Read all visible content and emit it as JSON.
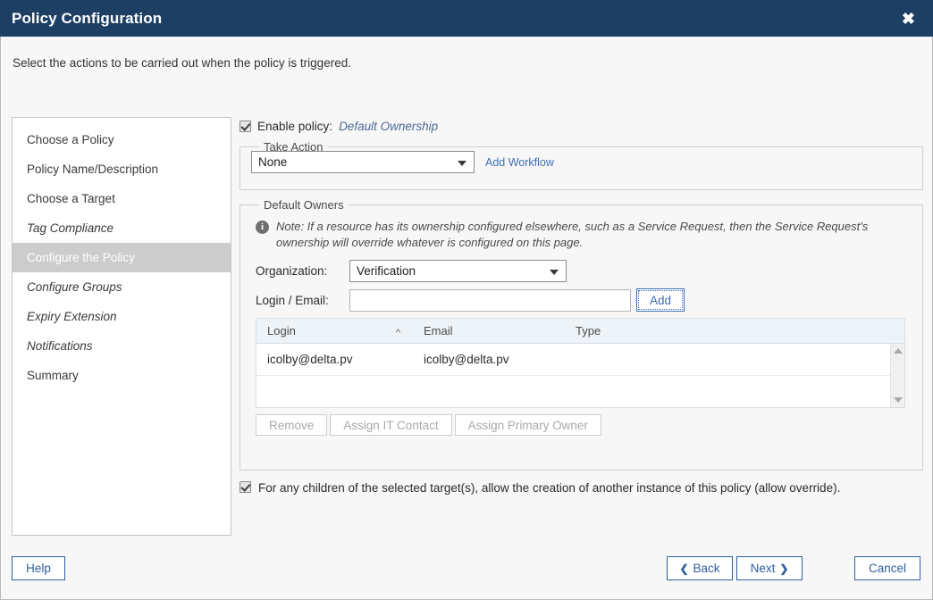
{
  "window": {
    "title": "Policy Configuration",
    "close_icon": "close-icon",
    "close_glyph": "✖"
  },
  "intro": "Select the actions to be carried out when the policy is triggered.",
  "sidebar": {
    "items": [
      {
        "label": "Choose a Policy",
        "style": "normal",
        "active": false
      },
      {
        "label": "Policy Name/Description",
        "style": "normal",
        "active": false
      },
      {
        "label": "Choose a Target",
        "style": "normal",
        "active": false
      },
      {
        "label": "Tag Compliance",
        "style": "italic",
        "active": false
      },
      {
        "label": "Configure the Policy",
        "style": "normal",
        "active": true
      },
      {
        "label": "Configure Groups",
        "style": "italic",
        "active": false
      },
      {
        "label": "Expiry Extension",
        "style": "italic",
        "active": false
      },
      {
        "label": "Notifications",
        "style": "italic",
        "active": false
      },
      {
        "label": "Summary",
        "style": "normal",
        "active": false
      }
    ]
  },
  "enable_policy": {
    "checked": true,
    "label": "Enable policy:",
    "policy_name": "Default Ownership"
  },
  "take_action": {
    "legend": "Take Action",
    "select_value": "None",
    "select_options": [
      "None"
    ],
    "add_workflow_link": "Add Workflow"
  },
  "default_owners": {
    "legend": "Default Owners",
    "note_icon": "info-icon",
    "note": "Note: If a resource has its ownership configured elsewhere, such as a Service Request, then the Service Request's ownership will override whatever is configured on this page.",
    "organization_label": "Organization:",
    "organization_value": "Verification",
    "organization_options": [
      "Verification"
    ],
    "login_label": "Login / Email:",
    "login_value": "",
    "login_placeholder": "",
    "add_label": "Add",
    "table": {
      "columns": [
        "Login",
        "Email",
        "Type"
      ],
      "sort_column": "Login",
      "sort_caret": "^",
      "rows": [
        {
          "login": "icolby@delta.pv",
          "email": "icolby@delta.pv",
          "type": ""
        }
      ]
    },
    "actions": [
      {
        "label": "Remove",
        "enabled": false
      },
      {
        "label": "Assign IT Contact",
        "enabled": false
      },
      {
        "label": "Assign Primary Owner",
        "enabled": false
      }
    ]
  },
  "override": {
    "checked": true,
    "text": "For any children of the selected target(s), allow the creation of another instance of this policy (allow override)."
  },
  "footer": {
    "help": "Help",
    "back": "Back",
    "back_chevron": "❮",
    "next": "Next",
    "next_chevron": "❯",
    "cancel": "Cancel"
  },
  "colors": {
    "titlebar": "#1d3f63",
    "accent_link": "#3f6fb5",
    "button_blue": "#2f5f9e",
    "active_nav": "#cccccc",
    "table_header": "#eef3f7"
  }
}
